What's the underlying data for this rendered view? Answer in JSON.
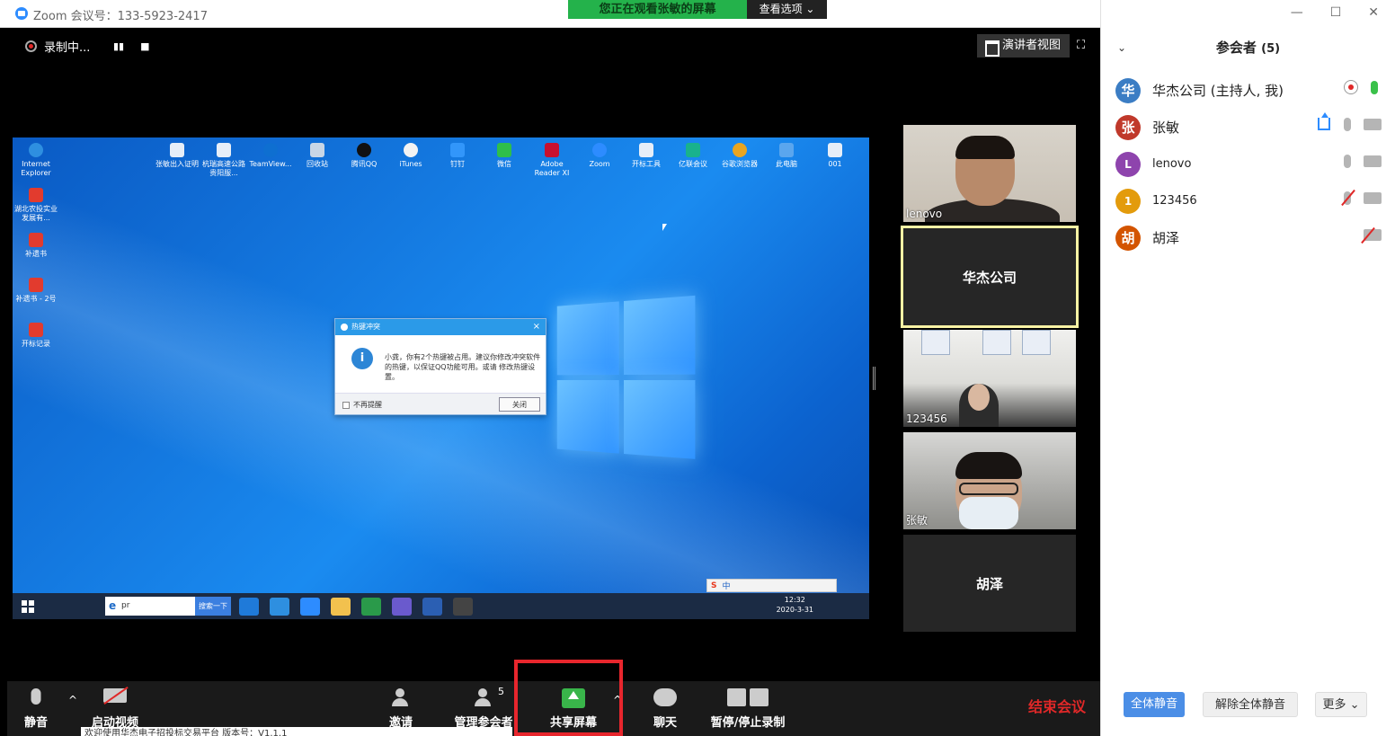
{
  "titlebar": {
    "title": "Zoom 会议号：133-5923-2417"
  },
  "viewing": {
    "label": "您正在观看张敏的屏幕",
    "options": "查看选项 ⌄"
  },
  "recording": {
    "status": "录制中...",
    "pause": "▮▮",
    "stop": "■"
  },
  "speaker_view": "演讲者视图",
  "desktop": {
    "icons": [
      {
        "label": "Internet Explorer"
      },
      {
        "label": "湖北农投实业发展有..."
      },
      {
        "label": "补遗书"
      },
      {
        "label": "补遗书 - 2号"
      },
      {
        "label": "开标记录"
      },
      {
        "label": "张敏出入证明"
      },
      {
        "label": "杭瑞高速公路贵阳服..."
      },
      {
        "label": "TeamView..."
      },
      {
        "label": "回收站"
      },
      {
        "label": "腾讯QQ"
      },
      {
        "label": "iTunes"
      },
      {
        "label": "钉钉"
      },
      {
        "label": "微信"
      },
      {
        "label": "Adobe Reader XI"
      },
      {
        "label": "Zoom"
      },
      {
        "label": "开标工具"
      },
      {
        "label": "亿联会议"
      },
      {
        "label": "谷歌浏览器"
      },
      {
        "label": "此电脑"
      },
      {
        "label": "001"
      }
    ],
    "dialog": {
      "title": "热键冲突",
      "message": "小龚，你有2个热键被占用。建议你修改冲突软件的热键，以保证QQ功能可用。或请 修改热键设置。",
      "checkbox": "不再提醒",
      "close": "关闭",
      "close_x": "×"
    },
    "taskbar": {
      "search_text": "pr",
      "search_button": "搜索一下",
      "time": "12:32",
      "date": "2020-3-31",
      "ime": "中",
      "tray_badge": "1"
    }
  },
  "videos": [
    {
      "name": "lenovo"
    },
    {
      "name": "华杰公司"
    },
    {
      "name": "123456"
    },
    {
      "name": "张敏"
    },
    {
      "name": "胡泽"
    }
  ],
  "toolbar": {
    "mute": "静音",
    "start_video": "启动视频",
    "invite": "邀请",
    "manage": "管理参会者",
    "manage_count": "5",
    "share": "共享屏幕",
    "chat": "聊天",
    "record": "暂停/停止录制",
    "end": "结束会议",
    "caret": "^"
  },
  "behind_window": "欢迎使用华杰电子招投标交易平台  版本号：V1.1.1",
  "panel": {
    "title": "参会者",
    "count": "(5)",
    "collapse": "⌄",
    "participants": [
      {
        "initial": "华",
        "name": "华杰公司 (主持人, 我)",
        "color": "#3b7dc4"
      },
      {
        "initial": "张",
        "name": "张敏",
        "color": "#c0392b"
      },
      {
        "initial": "L",
        "name": "lenovo",
        "color": "#8e44ad"
      },
      {
        "initial": "1",
        "name": "123456",
        "color": "#e39b0c"
      },
      {
        "initial": "胡",
        "name": "胡泽",
        "color": "#d35400"
      }
    ],
    "mute_all": "全体静音",
    "unmute_all": "解除全体静音",
    "more": "更多 ⌄"
  },
  "window_controls": {
    "min": "—",
    "max": "☐",
    "close": "✕"
  },
  "fullscreen_icon": "⛶"
}
